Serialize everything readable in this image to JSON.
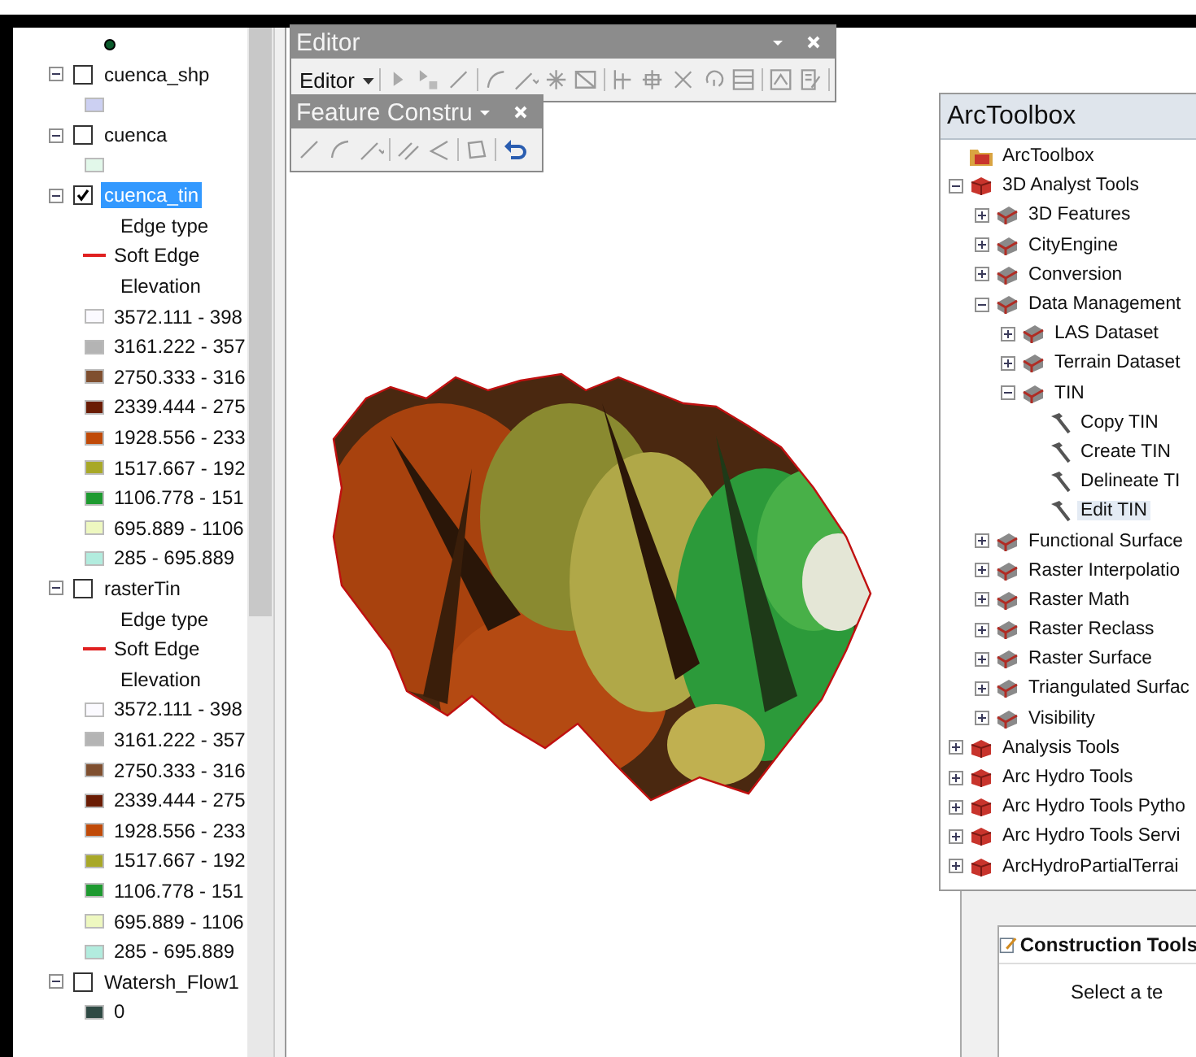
{
  "toc": {
    "top_legend": [
      {
        "kind": "point",
        "color": "#0b5a2c"
      }
    ],
    "layers": [
      {
        "name": "cuenca_shp",
        "expanded": true,
        "checked": false,
        "selected": false,
        "legend": [
          {
            "kind": "fill",
            "color": "#ccd0f2"
          }
        ]
      },
      {
        "name": "cuenca",
        "expanded": true,
        "checked": false,
        "selected": false,
        "legend": [
          {
            "kind": "fill",
            "color": "#e2f8ea"
          }
        ]
      },
      {
        "name": "cuenca_tin",
        "expanded": true,
        "checked": true,
        "selected": true,
        "legend": [
          {
            "kind": "heading",
            "label": "Edge type"
          },
          {
            "kind": "line",
            "label": "Soft Edge",
            "color": "#e02020"
          },
          {
            "kind": "heading",
            "label": "Elevation"
          },
          {
            "kind": "fill",
            "label": "3572.111 - 398",
            "color": "#fbfaff"
          },
          {
            "kind": "fill",
            "label": "3161.222 - 357",
            "color": "#b4b4b4"
          },
          {
            "kind": "fill",
            "label": "2750.333 - 316",
            "color": "#7f4f2f"
          },
          {
            "kind": "fill",
            "label": "2339.444 - 275",
            "color": "#6a1c04"
          },
          {
            "kind": "fill",
            "label": "1928.556 - 233",
            "color": "#c04a08"
          },
          {
            "kind": "fill",
            "label": "1517.667 - 192",
            "color": "#a8a828"
          },
          {
            "kind": "fill",
            "label": "1106.778 - 151",
            "color": "#1e9a30"
          },
          {
            "kind": "fill",
            "label": "695.889 - 1106",
            "color": "#eef8c0"
          },
          {
            "kind": "fill",
            "label": "285 - 695.889",
            "color": "#b2ecde"
          }
        ]
      },
      {
        "name": "rasterTin",
        "expanded": true,
        "checked": false,
        "selected": false,
        "legend": [
          {
            "kind": "heading",
            "label": "Edge type"
          },
          {
            "kind": "line",
            "label": "Soft Edge",
            "color": "#e02020"
          },
          {
            "kind": "heading",
            "label": "Elevation"
          },
          {
            "kind": "fill",
            "label": "3572.111 - 398",
            "color": "#fbfaff"
          },
          {
            "kind": "fill",
            "label": "3161.222 - 357",
            "color": "#b4b4b4"
          },
          {
            "kind": "fill",
            "label": "2750.333 - 316",
            "color": "#7f4f2f"
          },
          {
            "kind": "fill",
            "label": "2339.444 - 275",
            "color": "#6a1c04"
          },
          {
            "kind": "fill",
            "label": "1928.556 - 233",
            "color": "#c04a08"
          },
          {
            "kind": "fill",
            "label": "1517.667 - 192",
            "color": "#a8a828"
          },
          {
            "kind": "fill",
            "label": "1106.778 - 151",
            "color": "#1e9a30"
          },
          {
            "kind": "fill",
            "label": "695.889 - 1106",
            "color": "#eef8c0"
          },
          {
            "kind": "fill",
            "label": "285 - 695.889",
            "color": "#b2ecde"
          }
        ]
      },
      {
        "name": "Watersh_Flow1",
        "expanded": true,
        "checked": false,
        "selected": false,
        "legend": [
          {
            "kind": "fill",
            "label": "0",
            "color": "#2f4a44"
          }
        ]
      }
    ]
  },
  "editor_toolbar": {
    "title": "Editor",
    "menu": "Editor"
  },
  "feature_construction_toolbar": {
    "title": "Feature Constru"
  },
  "arctoolbox": {
    "title": "ArcToolbox",
    "tree": [
      {
        "label": "ArcToolbox",
        "kind": "root",
        "selected": false,
        "children": [
          {
            "label": "3D Analyst Tools",
            "kind": "toolbox",
            "expanded": true,
            "selected": false,
            "children": [
              {
                "label": "3D Features",
                "kind": "toolset",
                "expanded": false,
                "selected": false
              },
              {
                "label": "CityEngine",
                "kind": "toolset",
                "expanded": false,
                "selected": false
              },
              {
                "label": "Conversion",
                "kind": "toolset",
                "expanded": false,
                "selected": false
              },
              {
                "label": "Data Management",
                "kind": "toolset",
                "expanded": true,
                "selected": false,
                "children": [
                  {
                    "label": "LAS Dataset",
                    "kind": "toolset",
                    "expanded": false,
                    "selected": false
                  },
                  {
                    "label": "Terrain Dataset",
                    "kind": "toolset",
                    "expanded": false,
                    "selected": false
                  },
                  {
                    "label": "TIN",
                    "kind": "toolset",
                    "expanded": true,
                    "selected": false,
                    "children": [
                      {
                        "label": "Copy TIN",
                        "kind": "tool",
                        "selected": false
                      },
                      {
                        "label": "Create TIN",
                        "kind": "tool",
                        "selected": false
                      },
                      {
                        "label": "Delineate TI",
                        "kind": "tool",
                        "selected": false
                      },
                      {
                        "label": "Edit TIN",
                        "kind": "tool",
                        "selected": true
                      }
                    ]
                  }
                ]
              },
              {
                "label": "Functional Surface",
                "kind": "toolset",
                "expanded": false,
                "selected": false
              },
              {
                "label": "Raster Interpolatio",
                "kind": "toolset",
                "expanded": false,
                "selected": false
              },
              {
                "label": "Raster Math",
                "kind": "toolset",
                "expanded": false,
                "selected": false
              },
              {
                "label": "Raster Reclass",
                "kind": "toolset",
                "expanded": false,
                "selected": false
              },
              {
                "label": "Raster Surface",
                "kind": "toolset",
                "expanded": false,
                "selected": false
              },
              {
                "label": "Triangulated Surfac",
                "kind": "toolset",
                "expanded": false,
                "selected": false
              },
              {
                "label": "Visibility",
                "kind": "toolset",
                "expanded": false,
                "selected": false
              }
            ]
          },
          {
            "label": "Analysis Tools",
            "kind": "toolbox",
            "expanded": false,
            "selected": false
          },
          {
            "label": "Arc Hydro Tools",
            "kind": "toolbox",
            "expanded": false,
            "selected": false
          },
          {
            "label": "Arc Hydro Tools Pytho",
            "kind": "toolbox",
            "expanded": false,
            "selected": false
          },
          {
            "label": "Arc Hydro Tools Servi",
            "kind": "toolbox",
            "expanded": false,
            "selected": false
          },
          {
            "label": "ArcHydroPartialTerrai",
            "kind": "toolbox",
            "expanded": false,
            "selected": false
          }
        ]
      }
    ]
  },
  "construction_tools": {
    "title": "Construction Tools",
    "message": "Select a te"
  }
}
